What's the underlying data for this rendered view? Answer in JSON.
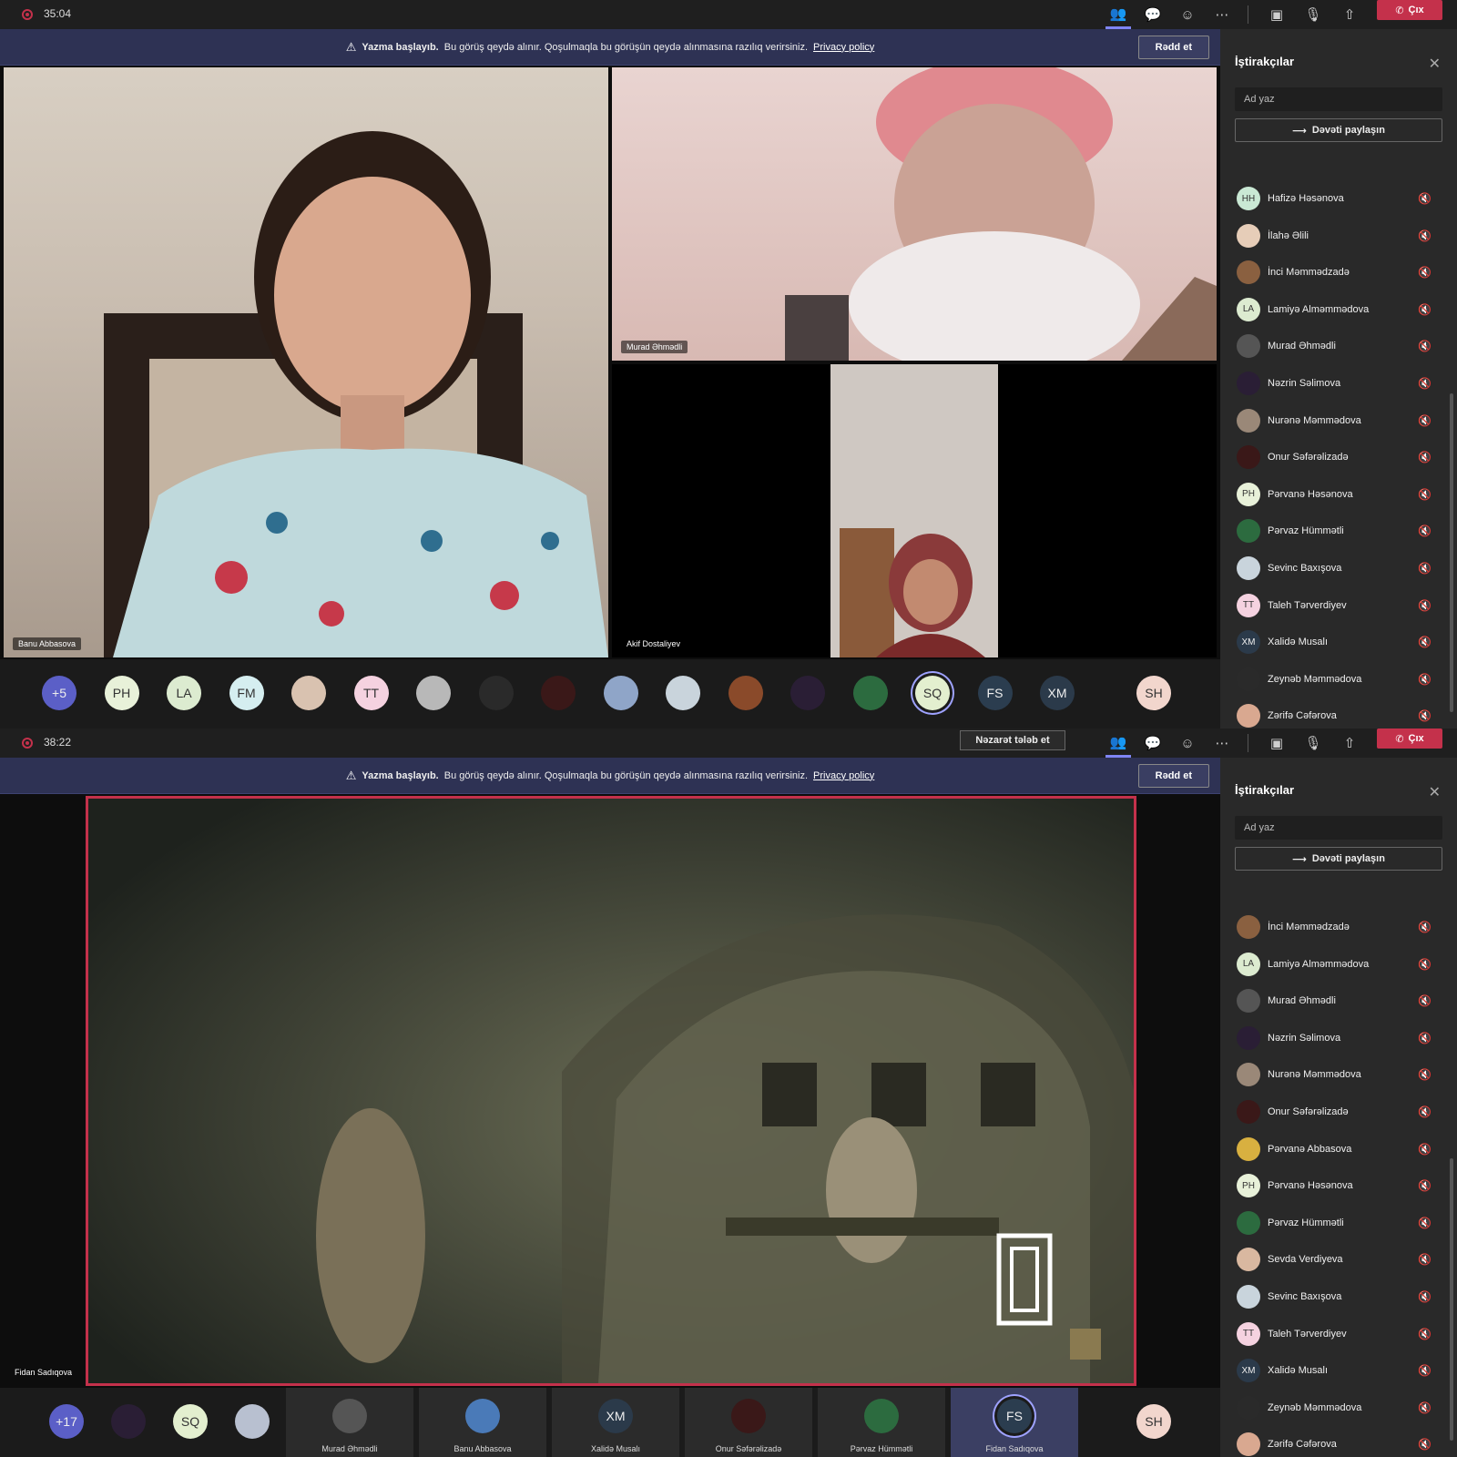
{
  "screenshots": [
    {
      "timer": "35:04",
      "banner": {
        "title": "Yazma başlayıb.",
        "message": "Bu görüş qeydə alınır. Qoşulmaqla bu görüşün qeydə alınmasına razılıq verirsiniz.",
        "link": "Privacy policy",
        "dismiss_label": "Rədd et"
      },
      "hangup_label": "Çıx",
      "tiles": {
        "main_name": "Banu Abbasova",
        "top_right_name": "Murad Əhmədli",
        "bottom_name": "Akif Dostaliyev"
      },
      "strip": [
        {
          "text": "+5",
          "color": "#5b5fc7",
          "dark": true
        },
        {
          "text": "PH",
          "color": "#e8f1d9"
        },
        {
          "text": "LA",
          "color": "#dcebd0"
        },
        {
          "text": "FM",
          "color": "#d5eef0"
        },
        {
          "text": "",
          "color": "#d9c2b0"
        },
        {
          "text": "TT",
          "color": "#f5d2e0"
        },
        {
          "text": "",
          "color": "#b8b8b8"
        },
        {
          "text": "",
          "color": "#2a2a2a"
        },
        {
          "text": "",
          "color": "#3a1818"
        },
        {
          "text": "",
          "color": "#8fa5c8"
        },
        {
          "text": "",
          "color": "#c9d4dc"
        },
        {
          "text": "",
          "color": "#8a4a2a"
        },
        {
          "text": "",
          "color": "#2a1e35"
        },
        {
          "text": "",
          "color": "#2c6b3f"
        },
        {
          "text": "SQ",
          "color": "#e3efcf"
        },
        {
          "text": "FS",
          "color": "#2b3d4f",
          "dark": true
        },
        {
          "text": "XM",
          "color": "#2b3a4a",
          "dark": true
        },
        {
          "text": "SH",
          "color": "#f2d6cd"
        }
      ],
      "panel": {
        "title": "İştirakçılar",
        "search_placeholder": "Ad yaz",
        "share_label": "Dəvəti paylaşın",
        "participants": [
          {
            "name": "Hafizə Həsənova",
            "initials": "HH",
            "color": "#c9e8d4"
          },
          {
            "name": "İlahə Əlili",
            "initials": "",
            "color": "#e6cdb8"
          },
          {
            "name": "İnci Məmmədzadə",
            "initials": "",
            "color": "#8a6040"
          },
          {
            "name": "Lamiyə Alməmmədova",
            "initials": "LA",
            "color": "#dcebd0"
          },
          {
            "name": "Murad Əhmədli",
            "initials": "",
            "color": "#555555"
          },
          {
            "name": "Nəzrin Səlimova",
            "initials": "",
            "color": "#2a1e35"
          },
          {
            "name": "Nurənə Məmmədova",
            "initials": "",
            "color": "#9a8878"
          },
          {
            "name": "Onur Səfərəlizadə",
            "initials": "",
            "color": "#3a1818"
          },
          {
            "name": "Pərvanə Həsənova",
            "initials": "PH",
            "color": "#e8f1d9"
          },
          {
            "name": "Pərvaz Hümmətli",
            "initials": "",
            "color": "#2c6b3f"
          },
          {
            "name": "Sevinc Baxışova",
            "initials": "",
            "color": "#c9d4dc"
          },
          {
            "name": "Taleh Tərverdiyev",
            "initials": "TT",
            "color": "#f5d2e0"
          },
          {
            "name": "Xalidə Musalı",
            "initials": "XM",
            "color": "#2b3a4a"
          },
          {
            "name": "Zeynəb Məmmədova",
            "initials": "",
            "color": "#2a2a2a"
          },
          {
            "name": "Zərifə Cəfərova",
            "initials": "",
            "color": "#d9a890"
          }
        ]
      }
    },
    {
      "timer": "38:22",
      "review_label": "Nəzarət tələb et",
      "banner": {
        "title": "Yazma başlayıb.",
        "message": "Bu görüş qeydə alınır. Qoşulmaqla bu görüşün qeydə alınmasına razılıq verirsiniz.",
        "link": "Privacy policy",
        "dismiss_label": "Rədd et"
      },
      "hangup_label": "Çıx",
      "tiles": {
        "share_name": "Fidan Sadıqova"
      },
      "strip_avatars": [
        {
          "text": "+17",
          "color": "#5b5fc7",
          "dark": true
        },
        {
          "text": "",
          "color": "#2a1e35"
        },
        {
          "text": "SQ",
          "color": "#e3efcf"
        },
        {
          "text": "",
          "color": "#b8c0d0"
        }
      ],
      "strip_tiles": [
        {
          "label": "Murad Əhmədli",
          "text": "",
          "color": "#555555"
        },
        {
          "label": "Banu Abbasova",
          "text": "",
          "color": "#4a7ab8"
        },
        {
          "label": "Xalidə Musalı",
          "text": "XM",
          "color": "#2b3a4a"
        },
        {
          "label": "Onur Səfərəlizadə",
          "text": "",
          "color": "#3a1818"
        },
        {
          "label": "Pərvaz Hümmətli",
          "text": "",
          "color": "#2c6b3f"
        },
        {
          "label": "Fidan Sadıqova",
          "text": "FS",
          "color": "#2b3d4f"
        }
      ],
      "strip_end": {
        "text": "SH",
        "color": "#f2d6cd"
      },
      "panel": {
        "title": "İştirakçılar",
        "search_placeholder": "Ad yaz",
        "share_label": "Dəvəti paylaşın",
        "participants": [
          {
            "name": "İnci Məmmədzadə",
            "initials": "",
            "color": "#8a6040"
          },
          {
            "name": "Lamiyə Alməmmədova",
            "initials": "LA",
            "color": "#dcebd0"
          },
          {
            "name": "Murad Əhmədli",
            "initials": "",
            "color": "#555555"
          },
          {
            "name": "Nəzrin Səlimova",
            "initials": "",
            "color": "#2a1e35"
          },
          {
            "name": "Nurənə Məmmədova",
            "initials": "",
            "color": "#9a8878"
          },
          {
            "name": "Onur Səfərəlizadə",
            "initials": "",
            "color": "#3a1818"
          },
          {
            "name": "Pərvanə Abbasova",
            "initials": "",
            "color": "#d8b040"
          },
          {
            "name": "Pərvanə Həsənova",
            "initials": "PH",
            "color": "#e8f1d9"
          },
          {
            "name": "Pərvaz Hümmətli",
            "initials": "",
            "color": "#2c6b3f"
          },
          {
            "name": "Sevda Verdiyeva",
            "initials": "",
            "color": "#d9b8a0"
          },
          {
            "name": "Sevinc Baxışova",
            "initials": "",
            "color": "#c9d4dc"
          },
          {
            "name": "Taleh Tərverdiyev",
            "initials": "TT",
            "color": "#f5d2e0"
          },
          {
            "name": "Xalidə Musalı",
            "initials": "XM",
            "color": "#2b3a4a"
          },
          {
            "name": "Zeynəb Məmmədova",
            "initials": "",
            "color": "#2a2a2a"
          },
          {
            "name": "Zərifə Cəfərova",
            "initials": "",
            "color": "#d9a890"
          }
        ]
      }
    }
  ]
}
